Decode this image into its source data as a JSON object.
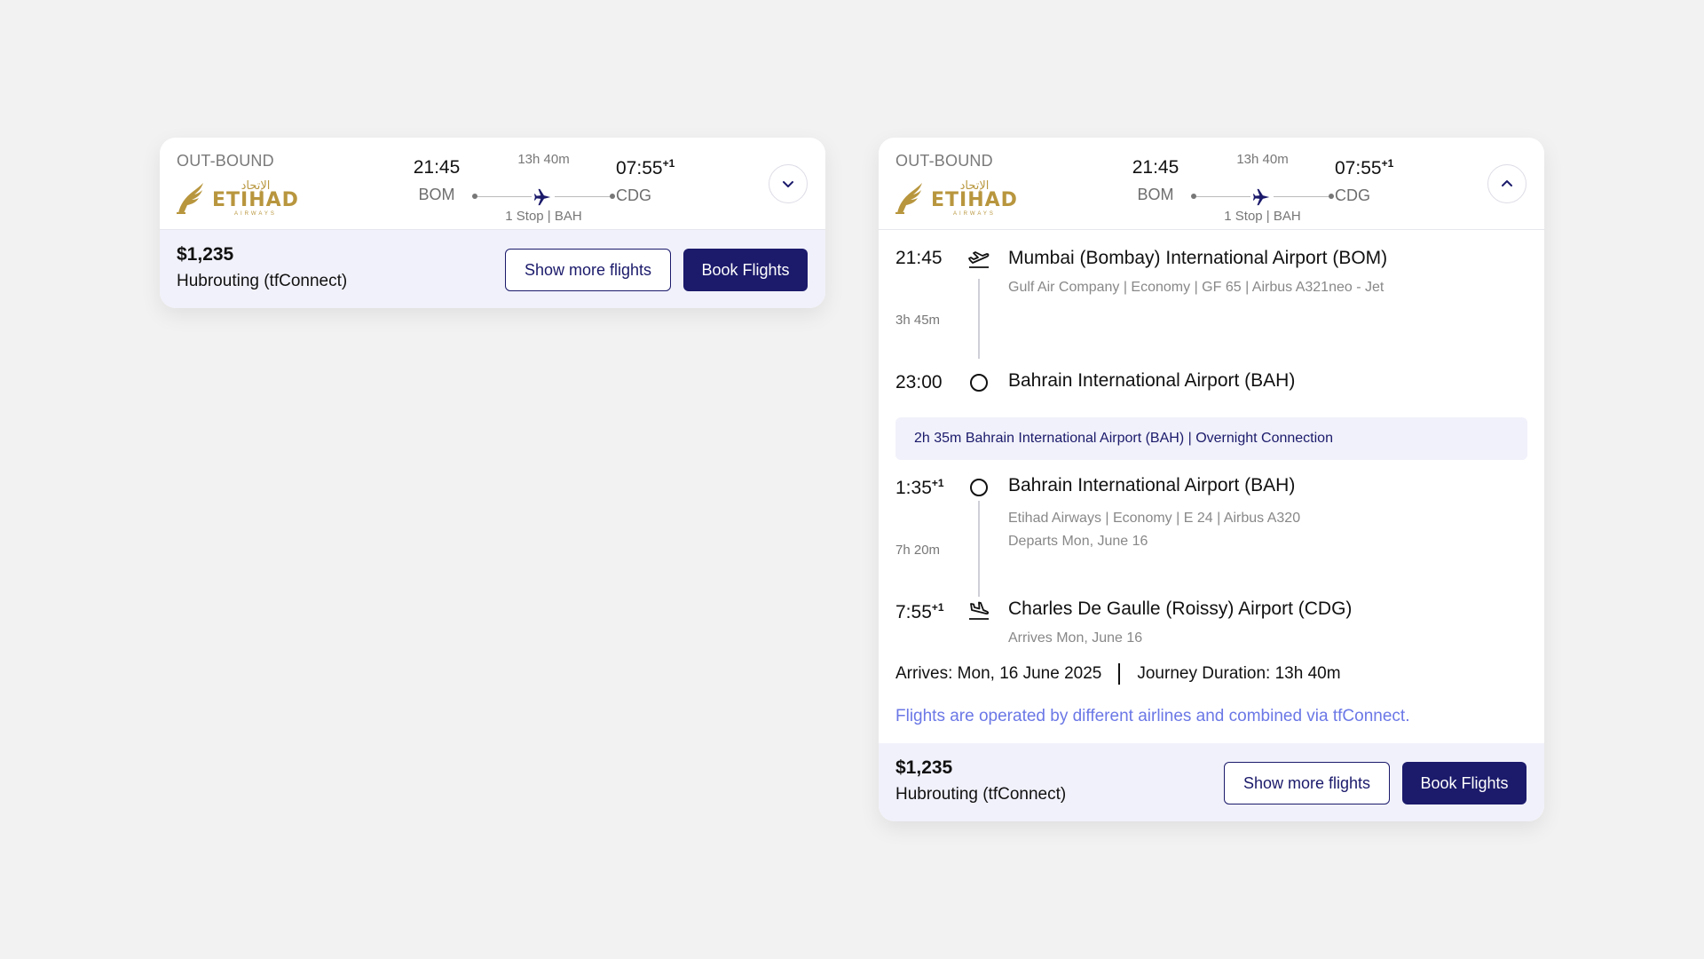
{
  "cards": {
    "collapsed": {
      "direction": "OUT-BOUND",
      "airline_logo": {
        "arabic": "الإتحاد",
        "name": "ETIHAD",
        "sub": "AIRWAYS"
      },
      "departure": {
        "time": "21:45",
        "code": "BOM"
      },
      "duration": "13h 40m",
      "stops": "1 Stop | BAH",
      "arrival": {
        "time": "07:55",
        "day_offset": "+1",
        "code": "CDG"
      },
      "toggle_icon": "chevron-down-icon",
      "price": "$1,235",
      "fare_type": "Hubrouting (tfConnect)",
      "show_more_label": "Show more flights",
      "book_label": "Book Flights"
    },
    "expanded": {
      "direction": "OUT-BOUND",
      "airline_logo": {
        "arabic": "الإتحاد",
        "name": "ETIHAD",
        "sub": "AIRWAYS"
      },
      "departure": {
        "time": "21:45",
        "code": "BOM"
      },
      "duration": "13h 40m",
      "stops": "1 Stop | BAH",
      "arrival": {
        "time": "07:55",
        "day_offset": "+1",
        "code": "CDG"
      },
      "toggle_icon": "chevron-up-icon",
      "segments": [
        {
          "dep_time": "21:45",
          "dep_airport": "Mumbai (Bombay) International Airport (BOM)",
          "info": "Gulf Air Company | Economy | GF 65 | Airbus A321neo - Jet",
          "flight_duration": "3h 45m",
          "arr_time": "23:00",
          "arr_airport": "Bahrain International Airport (BAH)"
        },
        {
          "dep_time": "1:35",
          "dep_day_offset": "+1",
          "dep_airport": "Bahrain International Airport (BAH)",
          "info": "Etihad Airways | Economy | E 24 | Airbus A320",
          "departs_note": "Departs Mon, June 16",
          "flight_duration": "7h 20m",
          "arr_time": "7:55",
          "arr_day_offset": "+1",
          "arr_airport": "Charles De Gaulle (Roissy) Airport (CDG)",
          "arrives_note": "Arrives Mon, June 16"
        }
      ],
      "layover": "2h 35m Bahrain International Airport (BAH) | Overnight Connection",
      "arrives_summary": "Arrives: Mon, 16 June 2025",
      "journey_duration": "Journey Duration: 13h 40m",
      "note": "Flights are operated by different airlines and combined via tfConnect.",
      "price": "$1,235",
      "fare_type": "Hubrouting (tfConnect)",
      "show_more_label": "Show more flights",
      "book_label": "Book Flights"
    }
  },
  "colors": {
    "primary": "#1b1a6b",
    "accent_link": "#6b78e6",
    "gold": "#b8963e",
    "panel": "#f1f1fb"
  }
}
